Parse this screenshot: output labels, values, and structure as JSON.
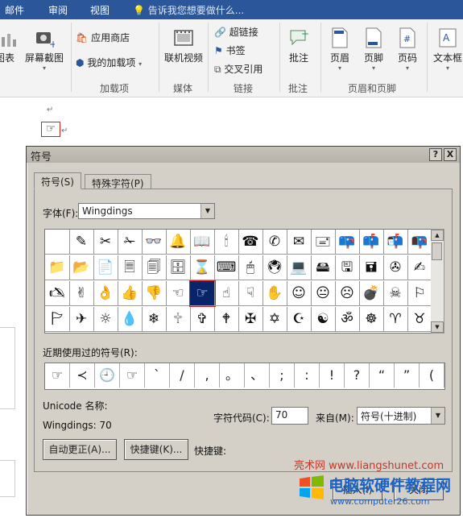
{
  "ribbon": {
    "tabs": [
      "邮件",
      "审阅",
      "视图"
    ],
    "tell_me": "告诉我您想要做什么...",
    "buttons": {
      "chart_partial": "图表",
      "screenshot": "屏幕截图",
      "app_store": "应用商店",
      "my_addins": "我的加载项",
      "online_video": "联机视频",
      "hyperlink": "超链接",
      "bookmark": "书签",
      "cross_ref": "交叉引用",
      "comment": "批注",
      "header": "页眉",
      "footer": "页脚",
      "page_number": "页码",
      "textbox_partial": "文本框"
    },
    "groups": {
      "addins": "加载项",
      "media": "媒体",
      "links": "链接",
      "comments": "批注",
      "header_footer": "页眉和页脚"
    }
  },
  "document": {
    "paragraph_mark_top": "↵",
    "inserted_symbol": "☞"
  },
  "dialog": {
    "title": "符号",
    "help_btn": "?",
    "close_btn": "X",
    "tabs": {
      "symbols": "符号(S)",
      "special": "特殊字符(P)"
    },
    "font_label": "字体(F):",
    "font_value": "Wingdings",
    "symbol_grid": [
      [
        "",
        "✎",
        "✂",
        "✁",
        "👓",
        "🔔",
        "📖",
        "🕯",
        "☎",
        "✆",
        "✉",
        "🖃",
        "📪",
        "📫",
        "📬",
        "📭"
      ],
      [
        "📁",
        "📂",
        "📄",
        "🗏",
        "🗐",
        "🗄",
        "⌛",
        "⌨",
        "🖱",
        "🖲",
        "💻",
        "🖴",
        "🖫",
        "🖬",
        "✇",
        "✍"
      ],
      [
        "🖎",
        "✌",
        "👌",
        "👍",
        "👎",
        "☜",
        "☞",
        "☝",
        "☟",
        "✋",
        "☺",
        "😐",
        "☹",
        "💣",
        "☠",
        "⚐"
      ],
      [
        "🏱",
        "✈",
        "☼",
        "💧",
        "❄",
        "🕆",
        "✞",
        "🕈",
        "✠",
        "✡",
        "☪",
        "☯",
        "ॐ",
        "☸",
        "♈",
        "♉"
      ]
    ],
    "selected": {
      "row": 2,
      "col": 6
    },
    "recent_label": "近期使用过的符号(R):",
    "recent_symbols": [
      "☞",
      "≺",
      "🕘",
      "☞",
      "ˋ",
      "/",
      ",",
      "。",
      "、",
      ";",
      ":",
      "!",
      "?",
      "“",
      "”",
      "("
    ],
    "unicode_name_label": "Unicode 名称:",
    "code_info": "Wingdings: 70",
    "char_code_label": "字符代码(C):",
    "char_code_value": "70",
    "from_label": "来自(M):",
    "from_value": "符号(十进制)",
    "autocorrect_btn": "自动更正(A)...",
    "shortcut_key_btn": "快捷键(K)...",
    "shortcut_label": "快捷键:",
    "insert_btn": "插入(I)",
    "cancel_btn": "关闭"
  },
  "watermark": {
    "site1": "亮术网 www.liangshunet.com",
    "site2_cn": "电脑软硬件教程网",
    "site2_url": "www.computer26.com"
  }
}
